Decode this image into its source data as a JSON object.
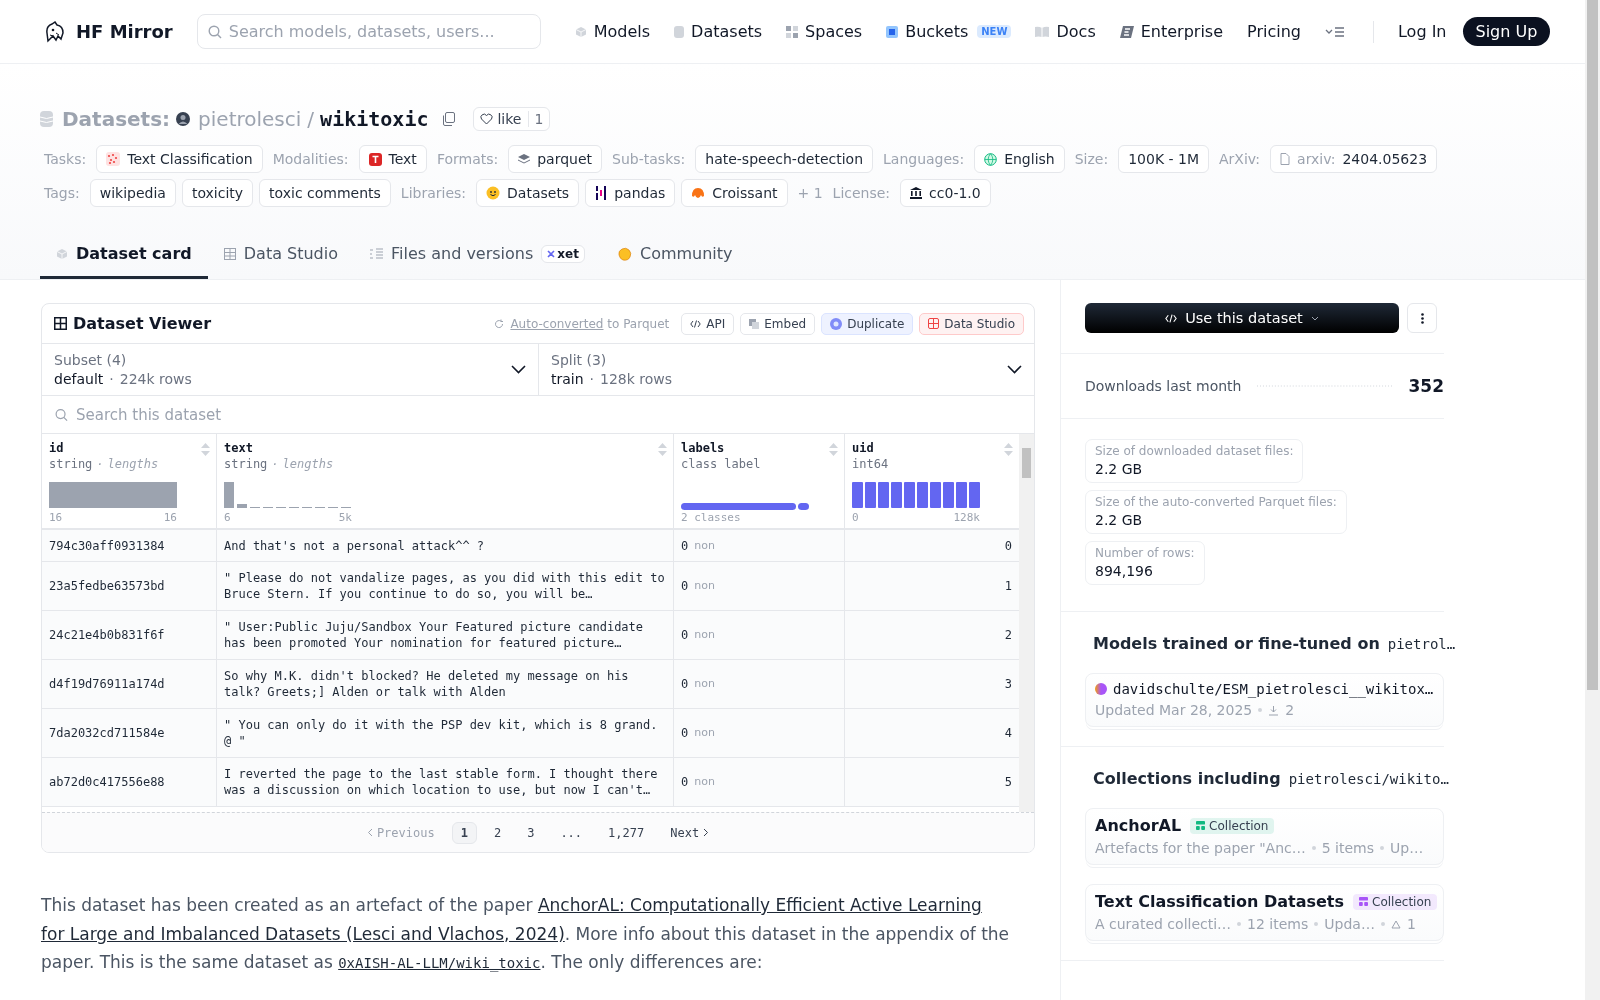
{
  "header": {
    "brand": "HF Mirror",
    "search": {
      "placeholder": "Search models, datasets, users..."
    },
    "nav": [
      {
        "label": "Models"
      },
      {
        "label": "Datasets"
      },
      {
        "label": "Spaces"
      },
      {
        "label": "Buckets",
        "badge": "NEW"
      },
      {
        "label": "Docs"
      },
      {
        "label": "Enterprise"
      },
      {
        "label": "Pricing"
      }
    ],
    "log_in": "Log In",
    "sign_up": "Sign Up"
  },
  "dataset": {
    "type_label": "Datasets:",
    "owner": "pietrolesci",
    "slash": "/",
    "name": "wikitoxic",
    "like": {
      "label": "like",
      "count": "1"
    }
  },
  "meta_rows": [
    [
      {
        "label": "Tasks:",
        "chips": [
          {
            "text": "Text Classification"
          }
        ]
      },
      {
        "label": "Modalities:",
        "chips": [
          {
            "text": "Text"
          }
        ]
      },
      {
        "label": "Formats:",
        "chips": [
          {
            "text": "parquet"
          }
        ]
      },
      {
        "label": "Sub-tasks:",
        "chips": [
          {
            "text": "hate-speech-detection"
          }
        ]
      },
      {
        "label": "Languages:",
        "chips": [
          {
            "text": "English"
          }
        ]
      },
      {
        "label": "Size:",
        "chips": [
          {
            "text": "100K - 1M"
          }
        ]
      },
      {
        "label": "ArXiv:",
        "chips": [
          {
            "prefix": "arxiv:",
            "text": "2404.05623"
          }
        ]
      }
    ],
    [
      {
        "label": "Tags:",
        "chips": [
          {
            "text": "wikipedia"
          },
          {
            "text": "toxicity"
          },
          {
            "text": "toxic comments"
          }
        ]
      },
      {
        "label": "Libraries:",
        "chips": [
          {
            "text": "Datasets"
          },
          {
            "text": "pandas"
          },
          {
            "text": "Croissant"
          }
        ],
        "more": "+ 1"
      },
      {
        "label": "License:",
        "chips": [
          {
            "text": "cc0-1.0"
          }
        ]
      }
    ]
  ],
  "tabs": [
    {
      "label": "Dataset card",
      "selected": true
    },
    {
      "label": "Data Studio",
      "selected": false
    },
    {
      "label": "Files and versions",
      "selected": false,
      "badge": "xet"
    },
    {
      "label": "Community",
      "selected": false
    }
  ],
  "viewer": {
    "title": "Dataset Viewer",
    "converted": {
      "link": "Auto-converted",
      "rest": "to Parquet"
    },
    "actions": [
      {
        "label": "API",
        "kind": "plain"
      },
      {
        "label": "Embed",
        "kind": "plain"
      },
      {
        "label": "Duplicate",
        "kind": "duplicate"
      },
      {
        "label": "Data Studio",
        "kind": "studio"
      }
    ],
    "selectors": [
      {
        "label": "Subset (4)",
        "value": "default",
        "separator": "·",
        "detail": "224k rows"
      },
      {
        "label": "Split (3)",
        "value": "train",
        "separator": "·",
        "detail": "128k rows"
      }
    ],
    "search": {
      "placeholder": "Search this dataset"
    },
    "columns": [
      {
        "name": "id",
        "type": "string",
        "separator": "·",
        "stat": "lengths",
        "min": "16",
        "max": "16"
      },
      {
        "name": "text",
        "type": "string",
        "separator": "·",
        "stat": "lengths",
        "min": "6",
        "max": "5k"
      },
      {
        "name": "labels",
        "type": "class label",
        "summary": "2 classes"
      },
      {
        "name": "uid",
        "type": "int64",
        "min": "0",
        "max": "128k"
      }
    ],
    "rows": [
      {
        "id": "794c30aff0931384",
        "text": "And that's not a personal attack^^ ?",
        "label": "0",
        "label_name": "non",
        "uid": "0"
      },
      {
        "id": "23a5fedbe63573bd",
        "text": "\" Please do not vandalize pages, as you did with this edit to Bruce Stern. If you continue to do so, you will be…",
        "label": "0",
        "label_name": "non",
        "uid": "1"
      },
      {
        "id": "24c21e4b0b831f6f",
        "text": "\" User:Public Juju/Sandbox Your Featured picture candidate has been promoted Your nomination for featured picture…",
        "label": "0",
        "label_name": "non",
        "uid": "2"
      },
      {
        "id": "d4f19d76911a174d",
        "text": "So why M.K. didn't blocked? He deleted my message on his talk? Greets;] Alden or talk with Alden",
        "label": "0",
        "label_name": "non",
        "uid": "3"
      },
      {
        "id": "7da2032cd711584e",
        "text": "\" You can only do it with the PSP dev kit, which is 8 grand. @ \"",
        "label": "0",
        "label_name": "non",
        "uid": "4"
      },
      {
        "id": "ab72d0c417556e88",
        "text": "I reverted the page to the last stable form. I thought there was a discussion on which location to use, but now I can't…",
        "label": "0",
        "label_name": "non",
        "uid": "5"
      }
    ],
    "pagination": {
      "previous": "Previous",
      "pages": [
        {
          "label": "1",
          "selected": true
        },
        {
          "label": "2",
          "selected": false
        },
        {
          "label": "3",
          "selected": false
        },
        {
          "label": "...",
          "selected": false
        },
        {
          "label": "1,277",
          "selected": false
        }
      ],
      "next": "Next"
    }
  },
  "card_text": [
    {
      "text": "This dataset has been created as an artefact of the paper "
    },
    {
      "link": "AnchorAL: Computationally Efficient Active Learning"
    },
    {
      "link": "for Large and Imbalanced Datasets (Lesci and Vlachos, 2024)"
    },
    {
      "text": ". More info about this dataset in the appendix of the paper. This is the same dataset as "
    },
    {
      "code_link": "0xAISH-AL-LLM/wiki_toxic"
    },
    {
      "text": ". The only differences are:"
    }
  ],
  "sidebar": {
    "use_button": "Use this dataset",
    "downloads": {
      "label": "Downloads last month",
      "value": "352"
    },
    "stats": [
      {
        "label": "Size of downloaded dataset files:",
        "value": "2.2 GB"
      },
      {
        "label": "Size of the auto-converted Parquet files:",
        "value": "2.2 GB"
      },
      {
        "label": "Number of rows:",
        "value": "894,196"
      }
    ],
    "models": {
      "title": "Models trained or fine-tuned on",
      "repo": "pietrol…",
      "items": [
        {
          "name": "davidschulte/ESM_pietrolesci__wikitox…",
          "updated": "Updated Mar 28, 2025",
          "downloads": "2"
        }
      ]
    },
    "collections": {
      "title": "Collections including",
      "repo": "pietrolesci/wikito…",
      "items": [
        {
          "title": "AnchorAL",
          "badge": "Collection",
          "color": "#10b981",
          "description": "Artefacts for the paper \"Anc…",
          "count": "5 items",
          "updated": "Up…"
        },
        {
          "title": "Text Classification Datasets",
          "badge": "Collection",
          "color": "#a855f7",
          "description": "A curated collecti…",
          "count": "12 items",
          "updated": "Upda…",
          "likes": "1"
        }
      ]
    }
  }
}
